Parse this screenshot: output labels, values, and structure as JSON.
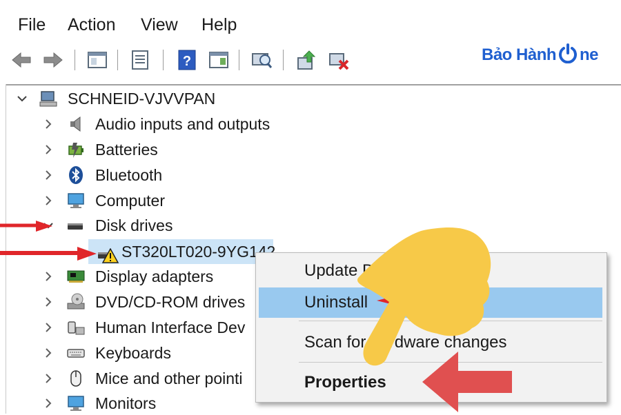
{
  "menu": {
    "items": [
      "File",
      "Action",
      "View",
      "Help"
    ]
  },
  "toolbar": {
    "buttons": [
      "back-icon",
      "forward-icon",
      "show-hide-console-tree-icon",
      "properties-icon",
      "help-icon",
      "action-pane-icon",
      "scan-hardware-icon",
      "update-driver-icon",
      "uninstall-device-icon"
    ]
  },
  "brand": {
    "part1": "Bảo Hành",
    "part2": "ne"
  },
  "tree": {
    "root": "SCHNEID-VJVVPAN",
    "categories": [
      "Audio inputs and outputs",
      "Batteries",
      "Bluetooth",
      "Computer",
      "Disk drives",
      "Display adapters",
      "DVD/CD-ROM drives",
      "Human Interface Dev",
      "Keyboards",
      "Mice and other pointi",
      "Monitors"
    ],
    "selected_device": "ST320LT020-9YG142"
  },
  "context_menu": {
    "items": [
      "Update Driver Software...",
      "Uninstall",
      "Scan for hardware changes",
      "Properties"
    ]
  },
  "colors": {
    "selection": "#cce4f7",
    "menu_highlight": "#99c9ef",
    "arrow": "#e0262a",
    "hand": "#f7c948",
    "brand": "#1f5fd0"
  }
}
